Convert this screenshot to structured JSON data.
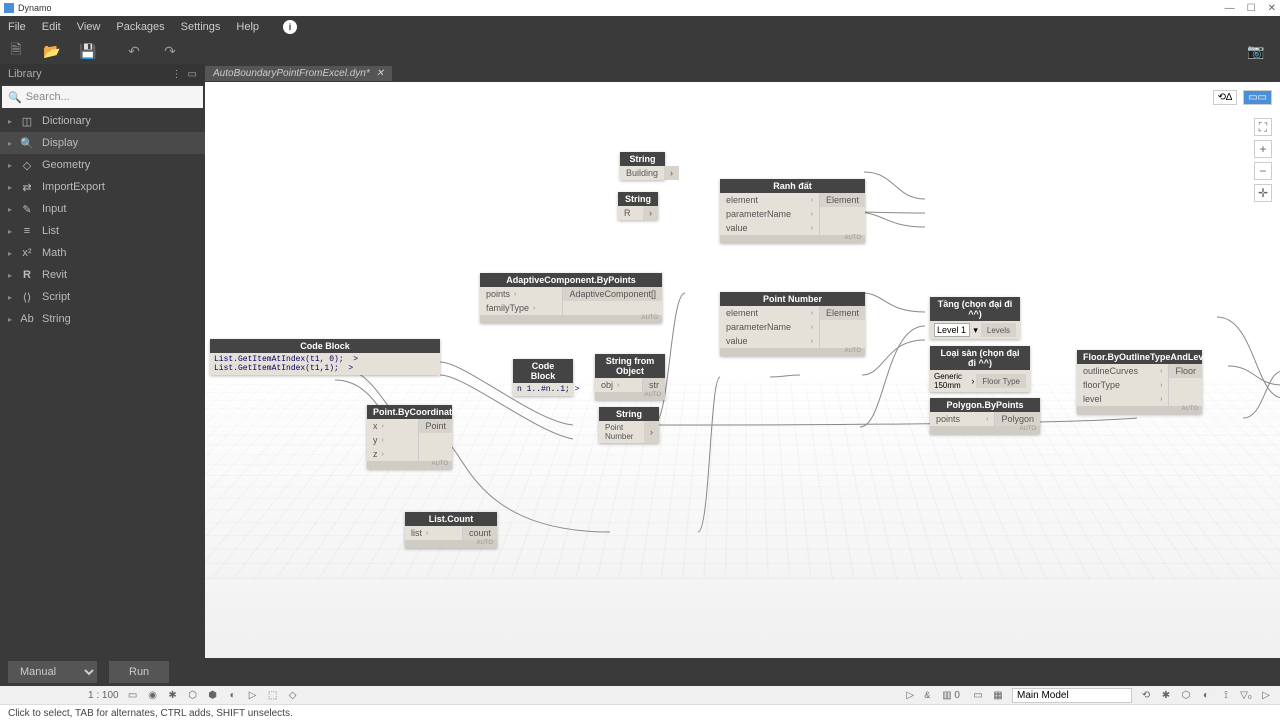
{
  "title": "Dynamo",
  "menu": [
    "File",
    "Edit",
    "View",
    "Packages",
    "Settings",
    "Help"
  ],
  "library": {
    "title": "Library",
    "search_placeholder": "Search...",
    "items": [
      "Dictionary",
      "Display",
      "Geometry",
      "ImportExport",
      "Input",
      "List",
      "Math",
      "Revit",
      "Script",
      "String"
    ]
  },
  "tab": "AutoBoundaryPointFromExcel.dyn*",
  "bottom": {
    "mode": "Manual",
    "run": "Run"
  },
  "revit": {
    "scale": "1 : 100",
    "model": "Main Model"
  },
  "status": "Click to select, TAB for alternates, CTRL adds, SHIFT unselects.",
  "nodes": {
    "codeblock1": {
      "title": "Code Block",
      "code": "List.GetItemAtIndex(t1, 0);  >\nList.GetItemAtIndex(t1,1);  >"
    },
    "pointbycoord": {
      "title": "Point.ByCoordinates",
      "in": [
        "x",
        "y",
        "z"
      ],
      "out": "Point"
    },
    "listcount": {
      "title": "List.Count",
      "in": [
        "list"
      ],
      "out": "count"
    },
    "codeblock2": {
      "title": "Code Block",
      "code": "n 1..#n..1; >"
    },
    "adaptive": {
      "title": "AdaptiveComponent.ByPoints",
      "in": [
        "points",
        "familyType"
      ],
      "out": "AdaptiveComponent[]"
    },
    "string1": {
      "title": "String",
      "val": "Building"
    },
    "string2": {
      "title": "String",
      "val": "R"
    },
    "string3": {
      "title": "String",
      "val": "Point Number"
    },
    "stringfromobj": {
      "title": "String from Object",
      "in": [
        "obj"
      ],
      "out": "str"
    },
    "ranhdat": {
      "title": "Ranh đất",
      "in": [
        "element",
        "parameterName",
        "value"
      ],
      "out": "Element"
    },
    "pointnum": {
      "title": "Point Number",
      "in": [
        "element",
        "parameterName",
        "value"
      ],
      "out": "Element"
    },
    "tang": {
      "title": "Tầng (chọn đại đi ^^)",
      "val": "Level 1",
      "out": "Levels"
    },
    "loaisan": {
      "title": "Loại sàn (chọn đại đi ^^)",
      "val": "Generic 150mm",
      "out": "Floor Type"
    },
    "polygon": {
      "title": "Polygon.ByPoints",
      "in": [
        "points"
      ],
      "out": "Polygon"
    },
    "floor": {
      "title": "Floor.ByOutlineTypeAndLevel",
      "in": [
        "outlineCurves",
        "floorType",
        "level"
      ],
      "out": "Floor"
    }
  }
}
